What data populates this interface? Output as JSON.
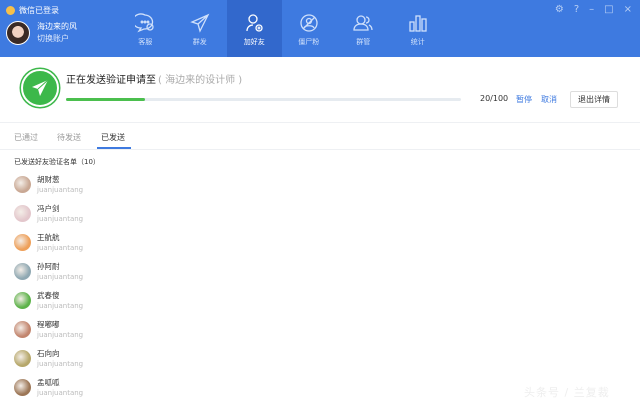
{
  "app": {
    "title": "微信已登录"
  },
  "user": {
    "name": "海边来的风",
    "switch_label": "切换账户"
  },
  "nav": [
    {
      "label": "客服",
      "icon": "chat-bubble-icon"
    },
    {
      "label": "群发",
      "icon": "paper-plane-icon"
    },
    {
      "label": "加好友",
      "icon": "add-user-icon",
      "active": true
    },
    {
      "label": "僵尸粉",
      "icon": "zombie-fan-icon"
    },
    {
      "label": "群管",
      "icon": "group-icon"
    },
    {
      "label": "统计",
      "icon": "bar-chart-icon"
    }
  ],
  "window": {
    "settings": "⚙",
    "help": "?",
    "minimize": "–",
    "maximize": "□",
    "close": "×"
  },
  "progress": {
    "title": "正在发送验证申请至",
    "target": "( 海边来的设计师 )",
    "count": "20/100",
    "percent": 20,
    "pause": "暂停",
    "cancel": "取消",
    "exit": "退出详情",
    "accent": "#3cb84a"
  },
  "tabs": [
    {
      "label": "已通过"
    },
    {
      "label": "待发送"
    },
    {
      "label": "已发送",
      "active": true
    }
  ],
  "list": {
    "header": "已发送好友验证名单（10）",
    "items": [
      {
        "name": "胡财葱",
        "sub": "juanjuantang",
        "color": "#c9a894"
      },
      {
        "name": "冯户剑",
        "sub": "juanjuantang",
        "color": "#e3c7cc"
      },
      {
        "name": "王航航",
        "sub": "juanjuantang",
        "color": "#eea05a"
      },
      {
        "name": "孙阿耐",
        "sub": "juanjuantang",
        "color": "#8fa8b2"
      },
      {
        "name": "武春傻",
        "sub": "juanjuantang",
        "color": "#5db34a"
      },
      {
        "name": "程嘟嘟",
        "sub": "juanjuantang",
        "color": "#c2856e"
      },
      {
        "name": "石向向",
        "sub": "juanjuantang",
        "color": "#b6a76a"
      },
      {
        "name": "孟呱呱",
        "sub": "juanjuantang",
        "color": "#9c7656"
      }
    ]
  },
  "watermark": "头条号 / 兰复裁"
}
